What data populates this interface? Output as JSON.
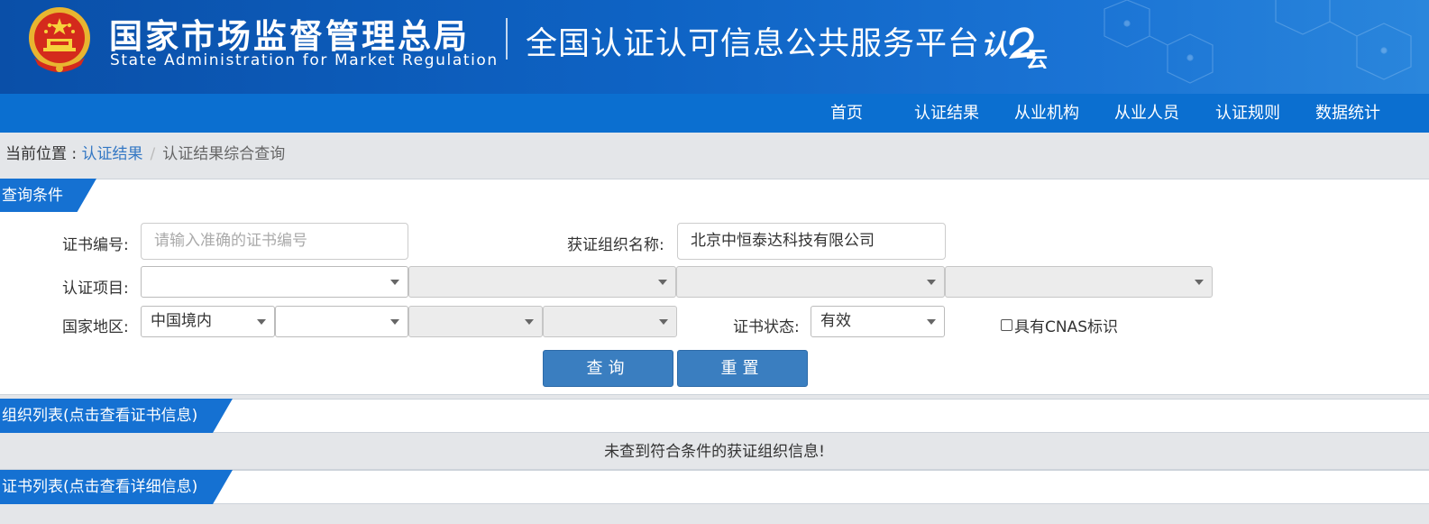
{
  "header": {
    "agency_cn": "国家市场监督管理总局",
    "agency_en": "State Administration  for  Market Regulation",
    "platform_title": "全国认证认可信息公共服务平台",
    "logo_glyph_a": "认",
    "logo_glyph_b": "云"
  },
  "nav": {
    "items": [
      {
        "label": "首页"
      },
      {
        "label": "认证结果"
      },
      {
        "label": "从业机构"
      },
      {
        "label": "从业人员"
      },
      {
        "label": "认证规则"
      },
      {
        "label": "数据统计"
      }
    ]
  },
  "breadcrumb": {
    "prefix": "当前位置 : ",
    "link": "认证结果",
    "separator": "/",
    "current": "认证结果综合查询"
  },
  "query": {
    "section_title": "查询条件",
    "cert_no": {
      "label": "证书编号:",
      "value": "",
      "placeholder": "请输入准确的证书编号"
    },
    "org_name": {
      "label": "获证组织名称:",
      "value": "北京中恒泰达科技有限公司"
    },
    "project": {
      "label": "认证项目:",
      "selects": [
        "",
        "",
        "",
        ""
      ]
    },
    "region": {
      "label": "国家地区:",
      "selects": [
        "中国境内",
        "",
        "",
        ""
      ]
    },
    "status": {
      "label": "证书状态:",
      "value": "有效"
    },
    "cnas_checkbox": {
      "label": "具有CNAS标识",
      "checked": false
    },
    "search_button": "查询",
    "reset_button": "重置"
  },
  "org_list": {
    "section_title": "组织列表(点击查看证书信息)",
    "empty_message": "未查到符合条件的获证组织信息!"
  },
  "cert_list": {
    "section_title": "证书列表(点击查看详细信息)"
  },
  "colors": {
    "header_blue": "#0e63c4",
    "nav_blue": "#0b6fd0",
    "section_tab_blue": "#1571d2",
    "button_blue": "#3a7ec0",
    "link_blue": "#3478c4"
  }
}
